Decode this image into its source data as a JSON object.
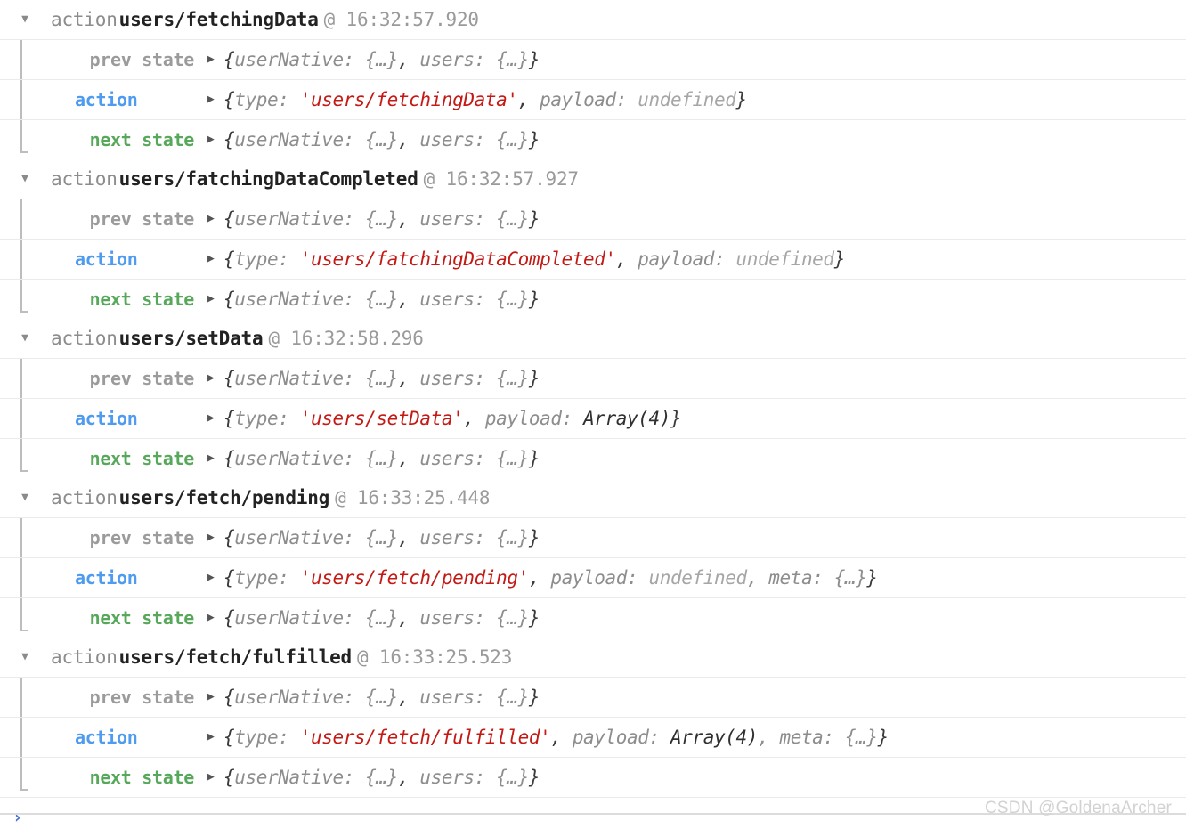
{
  "console": {
    "icons": {
      "disclosure_open": "▼",
      "disclosure_closed": "▶",
      "prompt_caret": "›"
    },
    "header_keyword": "action",
    "at_symbol": "@",
    "labels": {
      "prev_state": "prev state",
      "action": "action",
      "next_state": "next state"
    },
    "colors": {
      "prev_state": "#9b9b9b",
      "action": "#4f9bf0",
      "next_state": "#57a85b",
      "string": "#c41a16",
      "undefined": "#a6a6a6",
      "key": "#8d8d8d",
      "punct": "#3b3b3b",
      "action_type": "#222222",
      "timestamp": "#9a9a9a",
      "prompt": "#4a6fd6",
      "row_divider": "#ebebeb",
      "group_rule": "#bdbdbd",
      "watermark": "#d2d2d2"
    },
    "state_preview": {
      "open_brace": "{",
      "key1": "userNative: ",
      "val1": "{…}",
      "sep": ", ",
      "key2": "users: ",
      "val2": "{…}",
      "close_brace": "}"
    },
    "groups": [
      {
        "action_type": "users/fetchingData",
        "timestamp": "16:32:57.920",
        "action_preview": {
          "open": "{",
          "type_key": "type: ",
          "type_value": "'users/fetchingData'",
          "sep1": ", ",
          "payload_key": "payload: ",
          "payload_value": "undefined",
          "payload_kind": "undefined",
          "meta_key": "",
          "meta_value": "",
          "close": "}"
        }
      },
      {
        "action_type": "users/fatchingDataCompleted",
        "timestamp": "16:32:57.927",
        "action_preview": {
          "open": "{",
          "type_key": "type: ",
          "type_value": "'users/fatchingDataCompleted'",
          "sep1": ", ",
          "payload_key": "payload: ",
          "payload_value": "undefined",
          "payload_kind": "undefined",
          "meta_key": "",
          "meta_value": "",
          "close": "}"
        }
      },
      {
        "action_type": "users/setData",
        "timestamp": "16:32:58.296",
        "action_preview": {
          "open": "{",
          "type_key": "type: ",
          "type_value": "'users/setData'",
          "sep1": ", ",
          "payload_key": "payload: ",
          "payload_value": "Array(4)",
          "payload_kind": "value",
          "meta_key": "",
          "meta_value": "",
          "close": "}"
        }
      },
      {
        "action_type": "users/fetch/pending",
        "timestamp": "16:33:25.448",
        "action_preview": {
          "open": "{",
          "type_key": "type: ",
          "type_value": "'users/fetch/pending'",
          "sep1": ", ",
          "payload_key": "payload: ",
          "payload_value": "undefined",
          "payload_kind": "undefined",
          "meta_key": ", meta: ",
          "meta_value": "{…}",
          "close": "}"
        }
      },
      {
        "action_type": "users/fetch/fulfilled",
        "timestamp": "16:33:25.523",
        "action_preview": {
          "open": "{",
          "type_key": "type: ",
          "type_value": "'users/fetch/fulfilled'",
          "sep1": ", ",
          "payload_key": "payload: ",
          "payload_value": "Array(4)",
          "payload_kind": "value",
          "meta_key": ", meta: ",
          "meta_value": "{…}",
          "close": "}"
        }
      }
    ],
    "watermark": "CSDN @GoldenaArcher"
  }
}
